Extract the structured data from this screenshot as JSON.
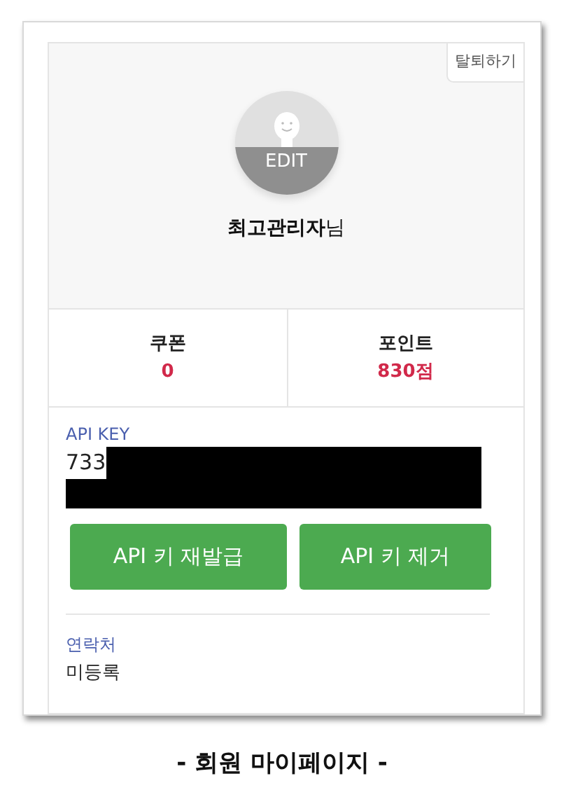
{
  "withdraw_button": "탈퇴하기",
  "avatar": {
    "edit_label": "EDIT"
  },
  "user_name": "**최고관리자**님",
  "stats": [
    {
      "label": "쿠폰",
      "value": "0"
    },
    {
      "label": "포인트",
      "value": "830점"
    }
  ],
  "api_key": {
    "label": "API KEY",
    "value": "733",
    "redacted": true
  },
  "buttons": [
    "API 키 재발급",
    "API 키 제거"
  ],
  "contact": {
    "label": "연락처",
    "value": "미등록"
  },
  "caption": "- 회원 마이페이지 -"
}
